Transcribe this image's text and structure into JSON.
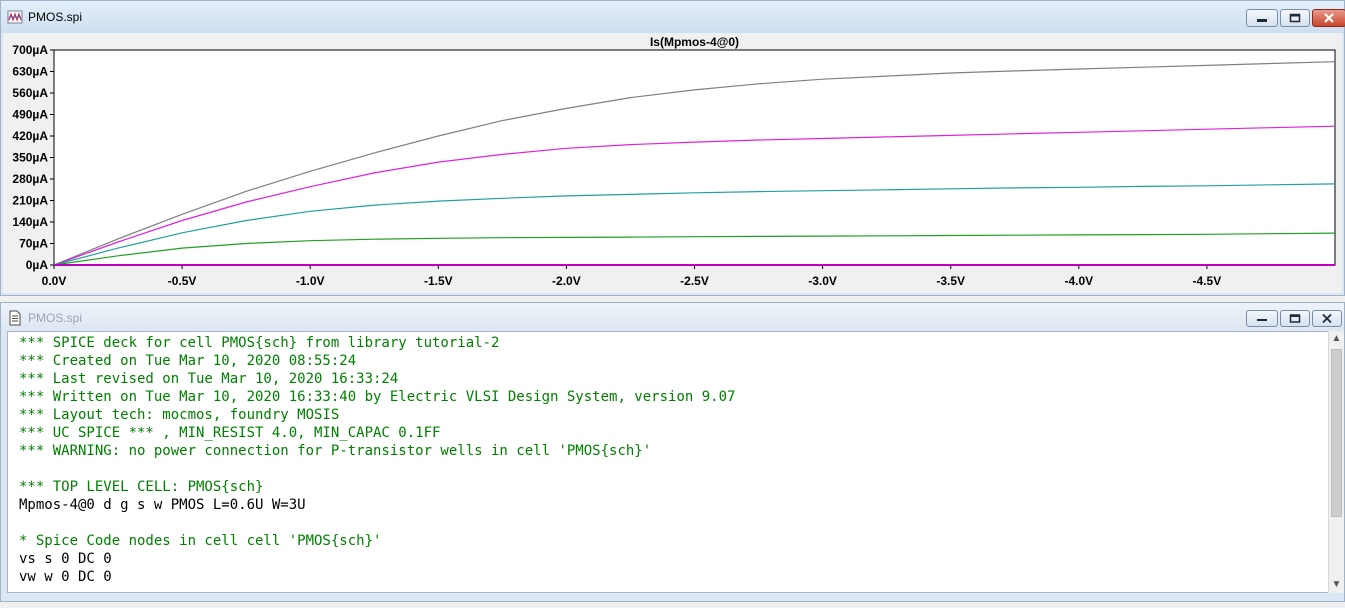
{
  "plot_window": {
    "title": "PMOS.spi",
    "icon": "waveform-icon"
  },
  "text_window": {
    "title": "PMOS.spi",
    "icon": "document-icon"
  },
  "chart_data": {
    "type": "line",
    "title": "Is(Mpmos-4@0)",
    "xlabel": "",
    "ylabel": "",
    "xlim": [
      0.0,
      -5.0
    ],
    "ylim": [
      0,
      700
    ],
    "x_ticks": [
      "0.0V",
      "-0.5V",
      "-1.0V",
      "-1.5V",
      "-2.0V",
      "-2.5V",
      "-3.0V",
      "-3.5V",
      "-4.0V",
      "-4.5V"
    ],
    "y_ticks": [
      "0µA",
      "70µA",
      "140µA",
      "210µA",
      "280µA",
      "350µA",
      "420µA",
      "490µA",
      "560µA",
      "630µA",
      "700µA"
    ],
    "grid": false,
    "x": [
      0.0,
      -0.25,
      -0.5,
      -0.75,
      -1.0,
      -1.25,
      -1.5,
      -1.75,
      -2.0,
      -2.25,
      -2.5,
      -2.75,
      -3.0,
      -3.25,
      -3.5,
      -3.75,
      -4.0,
      -4.25,
      -4.5,
      -4.75,
      -5.0
    ],
    "series": [
      {
        "color": "#808080",
        "values": [
          0,
          85,
          165,
          240,
          305,
          365,
          420,
          470,
          510,
          545,
          570,
          590,
          605,
          615,
          625,
          632,
          638,
          644,
          650,
          656,
          662
        ]
      },
      {
        "color": "#e020e0",
        "values": [
          0,
          75,
          145,
          205,
          255,
          300,
          335,
          360,
          380,
          392,
          400,
          407,
          412,
          417,
          422,
          427,
          432,
          437,
          442,
          447,
          452
        ]
      },
      {
        "color": "#20a0a0",
        "values": [
          0,
          55,
          105,
          145,
          175,
          195,
          208,
          217,
          225,
          230,
          235,
          239,
          242,
          245,
          248,
          251,
          253,
          256,
          258,
          261,
          264
        ]
      },
      {
        "color": "#20a020",
        "values": [
          0,
          30,
          55,
          70,
          79,
          84,
          87,
          89,
          90,
          91,
          92,
          93,
          94,
          95,
          96,
          97,
          98,
          99,
          100,
          102,
          104
        ]
      },
      {
        "color": "#c000c0",
        "values": [
          0,
          0,
          0,
          0,
          0,
          0,
          0,
          0,
          0,
          0,
          0,
          0,
          0,
          0,
          0,
          0,
          0,
          0,
          0,
          0,
          0
        ]
      }
    ]
  },
  "code_lines": [
    {
      "text": "*** SPICE deck for cell PMOS{sch} from library tutorial-2",
      "color": "#008000"
    },
    {
      "text": "*** Created on Tue Mar 10, 2020 08:55:24",
      "color": "#008000"
    },
    {
      "text": "*** Last revised on Tue Mar 10, 2020 16:33:24",
      "color": "#008000"
    },
    {
      "text": "*** Written on Tue Mar 10, 2020 16:33:40 by Electric VLSI Design System, version 9.07",
      "color": "#008000"
    },
    {
      "text": "*** Layout tech: mocmos, foundry MOSIS",
      "color": "#008000"
    },
    {
      "text": "*** UC SPICE *** , MIN_RESIST 4.0, MIN_CAPAC 0.1FF",
      "color": "#008000"
    },
    {
      "text": "*** WARNING: no power connection for P-transistor wells in cell 'PMOS{sch}'",
      "color": "#008000"
    },
    {
      "text": "",
      "color": "#000000"
    },
    {
      "text": "*** TOP LEVEL CELL: PMOS{sch}",
      "color": "#008000"
    },
    {
      "text": "Mpmos-4@0 d g s w PMOS L=0.6U W=3U",
      "color": "#000000"
    },
    {
      "text": "",
      "color": "#000000"
    },
    {
      "text": "* Spice Code nodes in cell cell 'PMOS{sch}'",
      "color": "#008000"
    },
    {
      "text": "vs s 0 DC 0",
      "color": "#000000"
    },
    {
      "text": "vw w 0 DC 0",
      "color": "#000000"
    }
  ]
}
